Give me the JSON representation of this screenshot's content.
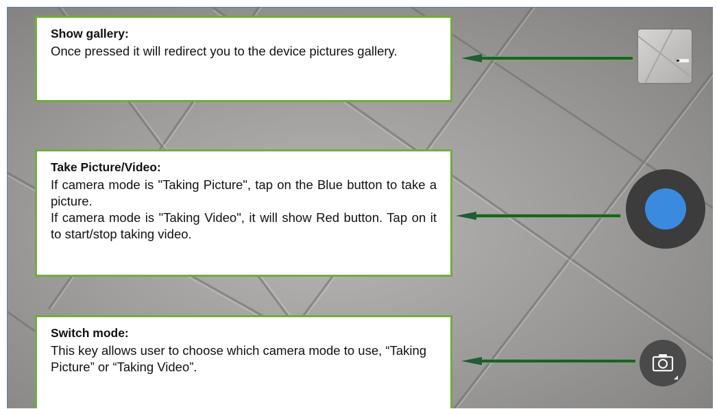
{
  "callouts": {
    "gallery": {
      "title": "Show gallery:",
      "description": "Once pressed it will redirect you to the device pictures gallery."
    },
    "capture": {
      "title": "Take Picture/Video:",
      "description": "If camera mode is \"Taking Picture\", tap on the Blue button to take a picture.\nIf camera mode is \"Taking Video\", it will show Red button. Tap on it to start/stop taking video."
    },
    "mode": {
      "title": "Switch mode:",
      "description": "This key allows user to choose which camera mode to use, “Taking Picture” or “Taking Video”."
    }
  },
  "controls": {
    "gallery_thumbnail_icon": "gallery-thumbnail",
    "shutter_icon": "shutter-button",
    "shutter_color": "#3a8be0",
    "mode_icon": "camera-icon"
  },
  "colors": {
    "callout_border": "#6fae3e",
    "arrow": "#1f5c38"
  }
}
